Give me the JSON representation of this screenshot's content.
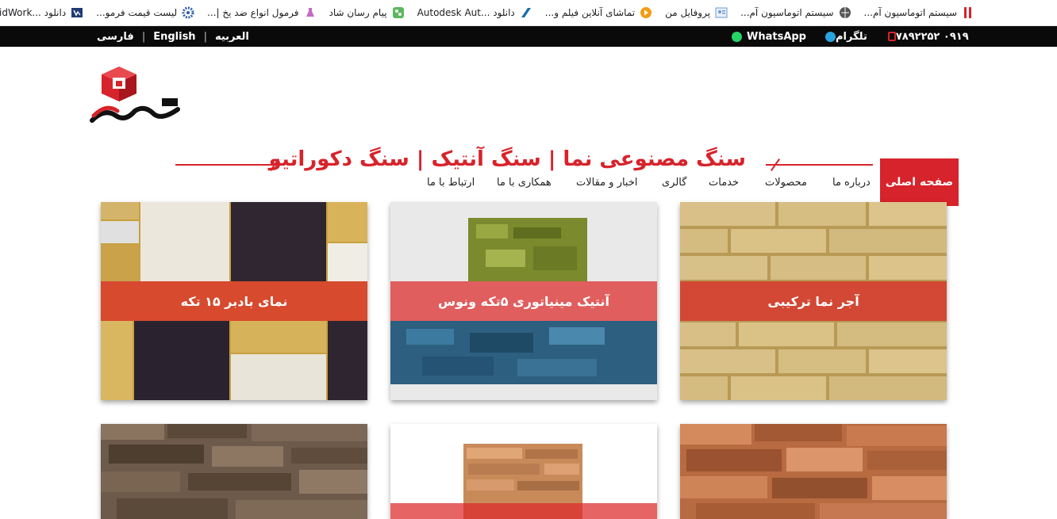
{
  "bookmarks": [
    {
      "label": "سیستم اتوماسیون آم...",
      "icon": "red-bars-icon"
    },
    {
      "label": "سیستم اتوماسیون آم...",
      "icon": "globe-icon"
    },
    {
      "label": "پروفایل من",
      "icon": "profile-icon"
    },
    {
      "label": "تماشای آنلاین فیلم و...",
      "icon": "play-icon"
    },
    {
      "label": "دانلود ...Autodesk Aut",
      "icon": "autodesk-icon"
    },
    {
      "label": "پیام رسان شاد",
      "icon": "shad-icon"
    },
    {
      "label": "فرمول انواع ضد یخ |...",
      "icon": "flask-icon"
    },
    {
      "label": "لیست قیمت فرمو...",
      "icon": "gear-icon"
    },
    {
      "label": "دانلود ...DS SolidWork",
      "icon": "solidworks-icon"
    }
  ],
  "topbar": {
    "phone": "۰۹۱۹ ۷۸۹۲۲۵۲",
    "telegram": "تلگرام",
    "whatsapp": "WhatsApp",
    "lang_ar": "العربيه",
    "lang_en": "English",
    "lang_fa": "فارسی"
  },
  "nav": {
    "home": "صفحه اصلی",
    "about": "درباره ما",
    "products": "محصولات",
    "services": "خدمات",
    "gallery": "گالری",
    "news": "اخبار و مقالات",
    "cooperation": "همکاری با ما",
    "contact": "ارتباط با ما"
  },
  "page": {
    "title": "سنگ مصنوعی نما | سنگ آنتیک | سنگ دکوراتیو"
  },
  "products": [
    {
      "label": "نمای بادبر ۱۵ تکه"
    },
    {
      "label": "آنتیک مینیاتوری ۵تکه ونوس"
    },
    {
      "label": "آجر نما ترکیبی"
    }
  ],
  "colors": {
    "accent": "#d7232b",
    "topbar": "#0a0a0a"
  }
}
